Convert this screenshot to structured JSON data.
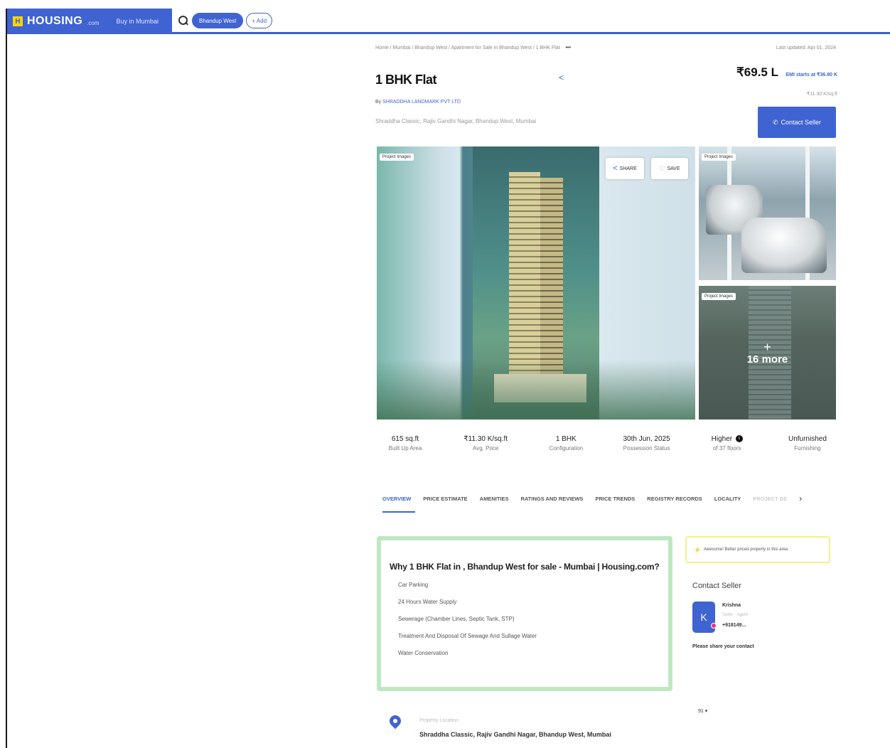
{
  "header": {
    "logo_mark": "H",
    "logo_text": "HOUSING",
    "logo_suffix": ".com",
    "city_link": "Buy in Mumbai",
    "locality_chip": "Bhandup West",
    "add_chip": "+ Add",
    "brand_color": "#3f63d1"
  },
  "breadcrumb": {
    "path": "Home / Mumbai / Bhandup West / Apartment for Sale in Bhandup West / 1 BHK Flat",
    "more": "•••",
    "updated": "Last updated: Apr 01, 2024"
  },
  "listing": {
    "title": "1 BHK Flat",
    "developer_prefix": "By",
    "developer": "SHRADDHA LANDMARK PVT LTD",
    "address": "Shraddha Classic, Rajiv Gandhi Nagar, Bhandup West, Mumbai",
    "price": "₹69.5 L",
    "emi": "EMI starts at ₹36.90 K",
    "price_per_sqft": "₹11.30 K/sq.ft",
    "contact_button": "Contact Seller"
  },
  "gallery": {
    "main_tag": "Project Images",
    "share_label": "SHARE",
    "save_label": "SAVE",
    "side_tag_1": "Project Images",
    "side_tag_2": "Project Images",
    "more_plus": "+",
    "more_label": "16 more"
  },
  "stats": [
    {
      "value": "615 sq.ft",
      "label": "Built Up Area"
    },
    {
      "value": "₹11.30 K/sq.ft",
      "label": "Avg. Price"
    },
    {
      "value": "1 BHK",
      "label": "Configuration"
    },
    {
      "value": "30th Jun, 2025",
      "label": "Possession Status"
    },
    {
      "value": "Higher",
      "badge": "i",
      "label": "of 37 floors"
    },
    {
      "value": "Unfurnished",
      "label": "Furnishing"
    }
  ],
  "tabs": [
    "OVERVIEW",
    "PRICE ESTIMATE",
    "AMENITIES",
    "RATINGS AND REVIEWS",
    "PRICE TRENDS",
    "REGISTRY RECORDS",
    "LOCALITY",
    "PROJECT DE"
  ],
  "overview": {
    "heading": "Why 1 BHK Flat in , Bhandup West for sale - Mumbai | Housing.com?",
    "points": [
      "Car Parking",
      "24 Hours Water Supply",
      "Sewerage (Chamber Lines, Septic Tank, STP)",
      "Treatment And Disposal Of Sewage And Sullage Water",
      "Water Conservation"
    ]
  },
  "side_panel": {
    "alert": "Awesome! Better priced property in this area",
    "seller_title": "Contact Seller",
    "avatar_initial": "K",
    "seller_name": "Krishna",
    "seller_meta": "Seller · Agent",
    "seller_phone": "+918149...",
    "share_contact": "Please share your contact",
    "misc": "91 ▾"
  },
  "location": {
    "label": "Property Location",
    "address": "Shraddha Classic, Rajiv Gandhi Nagar, Bhandup West, Mumbai"
  }
}
